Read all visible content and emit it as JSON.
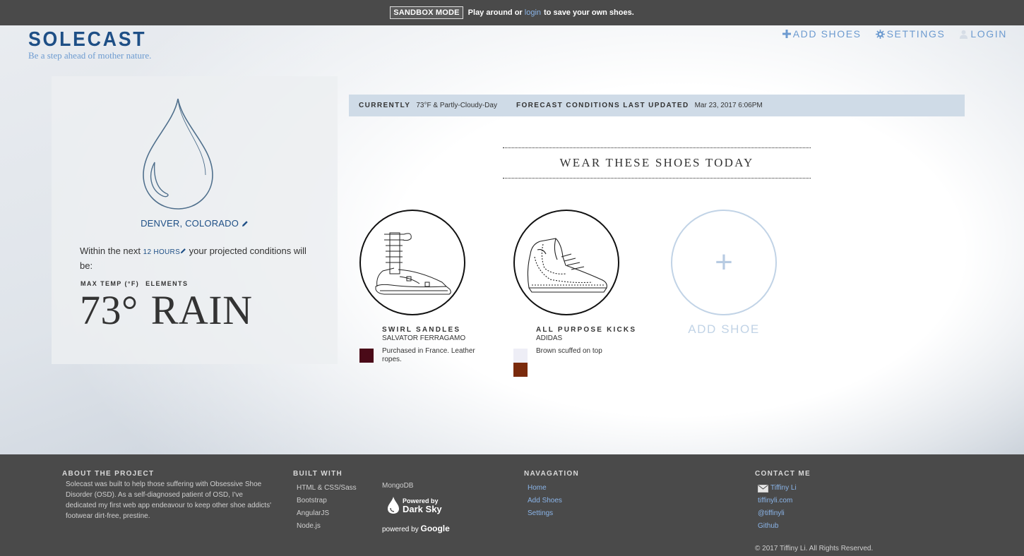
{
  "topbar": {
    "badge": "SANDBOX MODE",
    "text_before": "Play around or",
    "login_link": "login",
    "text_after": "to save your own shoes."
  },
  "header": {
    "logo": "SOLECAST",
    "tagline": "Be a step ahead of mother nature.",
    "nav": [
      {
        "label": "ADD SHOES",
        "icon": "plus-icon"
      },
      {
        "label": "SETTINGS",
        "icon": "gear-icon"
      },
      {
        "label": "LOGIN",
        "icon": "user-icon"
      }
    ]
  },
  "weather": {
    "icon": "raindrop-icon",
    "location": "DENVER, COLORADO",
    "within_prefix": "Within the next",
    "hours": "12 HOURS",
    "within_suffix": "your projected conditions will be:",
    "max_temp_label": "MAX TEMP (°F)",
    "elements_label": "ELEMENTS",
    "temp": "73°",
    "element": "RAIN"
  },
  "forecast": {
    "currently_label": "CURRENTLY",
    "currently_value": "73°F & Partly-Cloudy-Day",
    "updated_label": "FORECAST CONDITIONS LAST UPDATED",
    "updated_value": "Mar 23, 2017 6:06PM"
  },
  "recommendations": {
    "title": "WEAR THESE SHOES TODAY",
    "shoes": [
      {
        "name": "SWIRL SANDLES",
        "brand": "SALVATOR FERRAGAMO",
        "note": "Purchased in France. Leather ropes.",
        "colors": [
          "#4a0a18"
        ],
        "icon": "sandal-icon"
      },
      {
        "name": "ALL PURPOSE KICKS",
        "brand": "ADIDAS",
        "note": "Brown scuffed on top",
        "colors": [
          "#eeeef6",
          "#7a2a0c"
        ],
        "icon": "sneaker-icon"
      }
    ],
    "add_label": "ADD SHOE",
    "add_symbol": "+"
  },
  "footer": {
    "about": {
      "heading": "ABOUT THE PROJECT",
      "text": "Solecast was built to help those suffering with Obsessive Shoe Disorder (OSD). As a self-diagnosed patient of OSD, I've dedicated my first web app endeavour to keep other shoe addicts' footwear dirt-free, prestine."
    },
    "built": {
      "heading": "BUILT WITH",
      "col1": [
        "HTML & CSS/Sass",
        "Bootstrap",
        "AngularJS",
        "Node.js"
      ],
      "col2": [
        "MongoDB"
      ],
      "darksky_small": "Powered by",
      "darksky_big": "Dark Sky",
      "google_prefix": "powered by",
      "google_brand": "Google"
    },
    "nav": {
      "heading": "NAVAGATION",
      "links": [
        "Home",
        "Add Shoes",
        "Settings"
      ]
    },
    "contact": {
      "heading": "CONTACT ME",
      "links": [
        "Tiffiny Li",
        "tiffinyli.com",
        "@tiffinyli",
        "Github"
      ]
    },
    "copyright": "© 2017 Tiffiny Li. All Rights Reserved."
  }
}
